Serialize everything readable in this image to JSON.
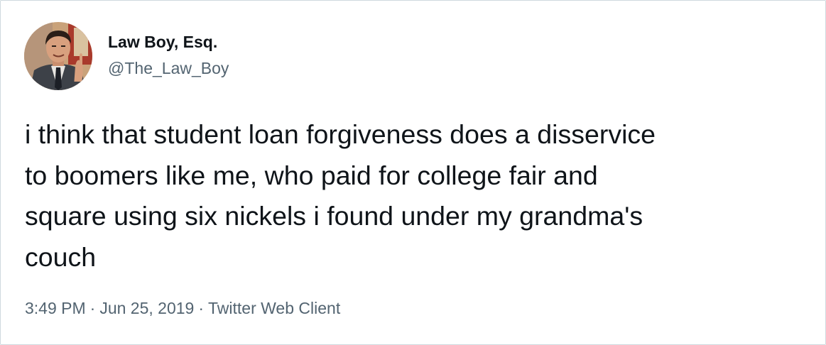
{
  "tweet": {
    "author": {
      "display_name": "Law Boy, Esq.",
      "handle": "@The_Law_Boy",
      "avatar_icon": "profile-photo"
    },
    "text": "i think that student loan forgiveness does a disservice\nto boomers like me, who paid for college fair and\nsquare using six nickels i found under my grandma's\ncouch",
    "meta": {
      "time": "3:49 PM",
      "separator": "·",
      "date": "Jun 25, 2019",
      "source": "Twitter Web Client"
    }
  },
  "colors": {
    "text_primary": "#0f1419",
    "text_secondary": "#536471",
    "border": "#cfd9de",
    "background": "#ffffff"
  }
}
